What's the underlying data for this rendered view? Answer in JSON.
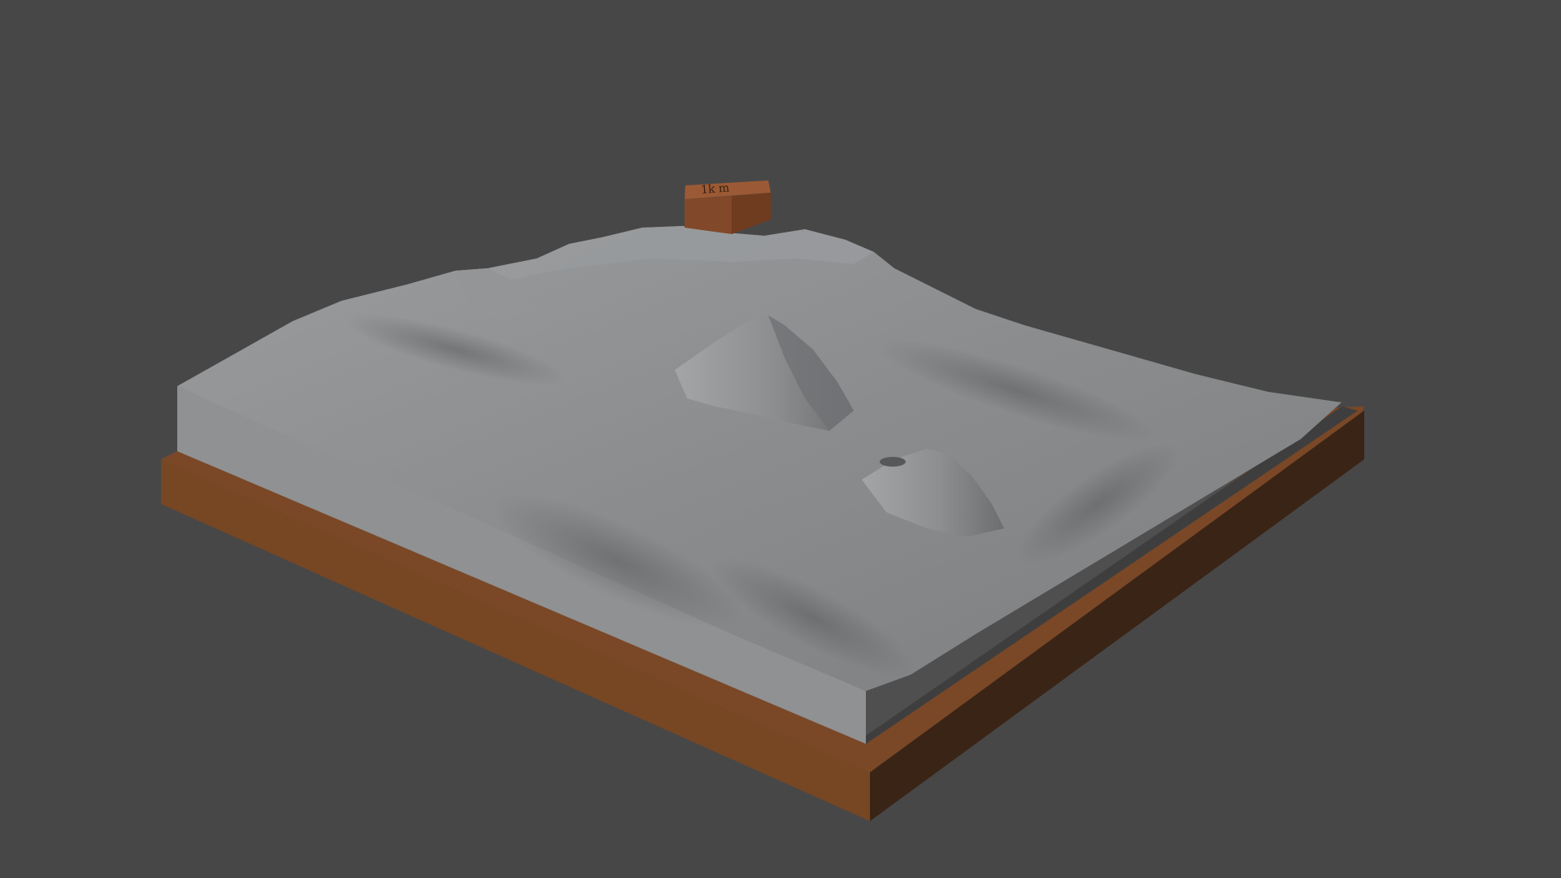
{
  "viewport": {
    "background_color": "#474747"
  },
  "model": {
    "base_color": "#774623",
    "base_side_color": "#3a2416",
    "terrain_color": "#8a8c8e",
    "terrain_side_color": "#9a9c9e",
    "label_block": {
      "color": "#82482a",
      "text": "1k m"
    }
  }
}
